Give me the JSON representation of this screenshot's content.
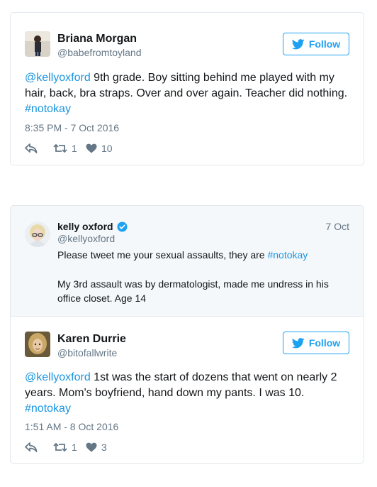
{
  "tweets": [
    {
      "author_name": "Briana Morgan",
      "author_handle": "@babefromtoyland",
      "follow_label": "Follow",
      "text": {
        "mention": "@kellyoxford",
        "line1_rest": " 9th grade. Boy sitting behind me played with my",
        "line2": "hair, back, bra straps. Over and over again. Teacher did nothing.",
        "hashtag": "#notokay"
      },
      "timestamp": "8:35 PM - 7 Oct 2016",
      "retweets": "1",
      "likes": "10"
    },
    {
      "author_name": "Karen Durrie",
      "author_handle": "@bitofallwrite",
      "follow_label": "Follow",
      "text": {
        "mention": "@kellyoxford",
        "line1_rest": " 1st was the start of dozens that went on nearly 2",
        "line2": "years. Mom's boyfriend, hand down my pants. I was 10.",
        "hashtag": "#notokay"
      },
      "timestamp": "1:51 AM - 8 Oct 2016",
      "retweets": "1",
      "likes": "3"
    }
  ],
  "quoted": {
    "author_name": "kelly oxford",
    "author_handle": "@kellyoxford",
    "date": "7 Oct",
    "line1_text": "Please tweet me your sexual assaults, they are ",
    "line1_hashtag": "#notokay",
    "line2": "My 3rd assault was by dermatologist, made me undress in his",
    "line3": "office closet. Age 14"
  },
  "colors": {
    "link": "#1b95e0",
    "follow": "#1da1f2",
    "muted": "#657786",
    "quoted_bg": "#f5f8fa",
    "border": "#e1e8ed"
  }
}
